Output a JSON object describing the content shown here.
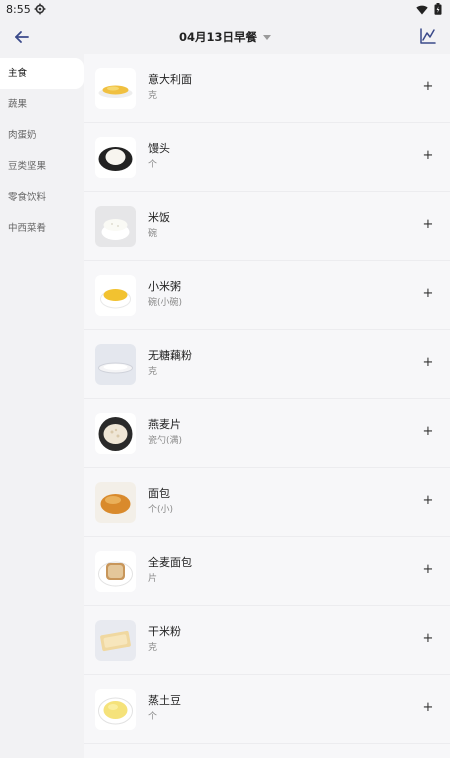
{
  "status_bar": {
    "time": "8:55"
  },
  "header": {
    "title": "04月13日早餐"
  },
  "sidebar": {
    "items": [
      {
        "label": "主食",
        "active": true
      },
      {
        "label": "蔬果",
        "active": false
      },
      {
        "label": "肉蛋奶",
        "active": false
      },
      {
        "label": "豆类坚果",
        "active": false
      },
      {
        "label": "零食饮料",
        "active": false
      },
      {
        "label": "中西菜肴",
        "active": false
      }
    ]
  },
  "foods": [
    {
      "name": "意大利面",
      "unit": "克",
      "add": "+"
    },
    {
      "name": "馒头",
      "unit": "个",
      "add": "+"
    },
    {
      "name": "米饭",
      "unit": "碗",
      "add": "+"
    },
    {
      "name": "小米粥",
      "unit": "碗(小碗)",
      "add": "+"
    },
    {
      "name": "无糖藕粉",
      "unit": "克",
      "add": "+"
    },
    {
      "name": "燕麦片",
      "unit": "瓷勺(满)",
      "add": "+"
    },
    {
      "name": "面包",
      "unit": "个(小)",
      "add": "+"
    },
    {
      "name": "全麦面包",
      "unit": "片",
      "add": "+"
    },
    {
      "name": "干米粉",
      "unit": "克",
      "add": "+"
    },
    {
      "name": "蒸土豆",
      "unit": "个",
      "add": "+"
    }
  ],
  "icons": {
    "back": "arrow-left-icon",
    "chart": "line-chart-icon",
    "settings": "gear-icon",
    "wifi": "wifi-icon",
    "battery": "battery-icon"
  },
  "colors": {
    "background": "#f2f2f4",
    "list_bg": "#f7f7f9",
    "active_category_bg": "#ffffff",
    "icon_accent": "#3b4a8a"
  }
}
